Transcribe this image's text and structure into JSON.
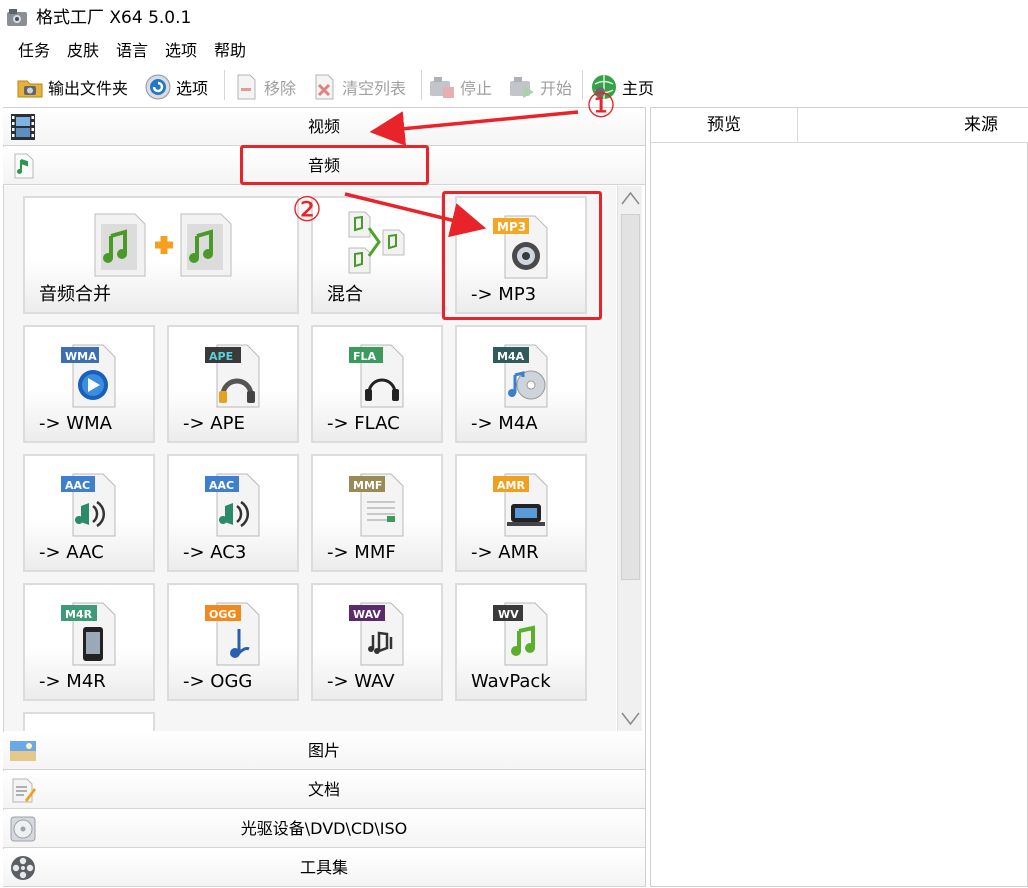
{
  "window": {
    "title": "格式工厂 X64 5.0.1"
  },
  "menu": [
    "任务",
    "皮肤",
    "语言",
    "选项",
    "帮助"
  ],
  "toolbar": {
    "output_folder": "输出文件夹",
    "options": "选项",
    "remove": "移除",
    "clear_list": "清空列表",
    "stop": "停止",
    "start": "开始",
    "home": "主页"
  },
  "categories": {
    "video": "视频",
    "audio": "音频",
    "image": "图片",
    "document": "文档",
    "disc": "光驱设备\\DVD\\CD\\ISO",
    "tools": "工具集"
  },
  "audio_tiles": [
    {
      "label": "音频合并"
    },
    {
      "label": "混合"
    },
    {
      "label": "-> MP3",
      "badge": "MP3",
      "badge_color": "#f5a623"
    },
    {
      "label": "-> WMA",
      "badge": "WMA",
      "badge_color": "#3b6fb0"
    },
    {
      "label": "-> APE",
      "badge": "APE",
      "badge_color": "#3a3a3a"
    },
    {
      "label": "-> FLAC",
      "badge": "FLA",
      "badge_color": "#3c9a5f"
    },
    {
      "label": "-> M4A",
      "badge": "M4A",
      "badge_color": "#2f5b5b"
    },
    {
      "label": "-> AAC",
      "badge": "AAC",
      "badge_color": "#3f7fd0"
    },
    {
      "label": "-> AC3",
      "badge": "AAC",
      "badge_color": "#3f7fd0"
    },
    {
      "label": "-> MMF",
      "badge": "MMF",
      "badge_color": "#9a8a55"
    },
    {
      "label": "-> AMR",
      "badge": "AMR",
      "badge_color": "#f0a020"
    },
    {
      "label": "-> M4R",
      "badge": "M4R",
      "badge_color": "#3f9a7a"
    },
    {
      "label": "-> OGG",
      "badge": "OGG",
      "badge_color": "#f08a20"
    },
    {
      "label": "-> WAV",
      "badge": "WAV",
      "badge_color": "#5a2a6a"
    },
    {
      "label": "WavPack",
      "badge": "WV",
      "badge_color": "#3a3a3a"
    }
  ],
  "right_panel": {
    "col_preview": "预览",
    "col_source": "来源"
  },
  "annotations": {
    "step1": "①",
    "step2": "②",
    "color": "#e8232a"
  }
}
